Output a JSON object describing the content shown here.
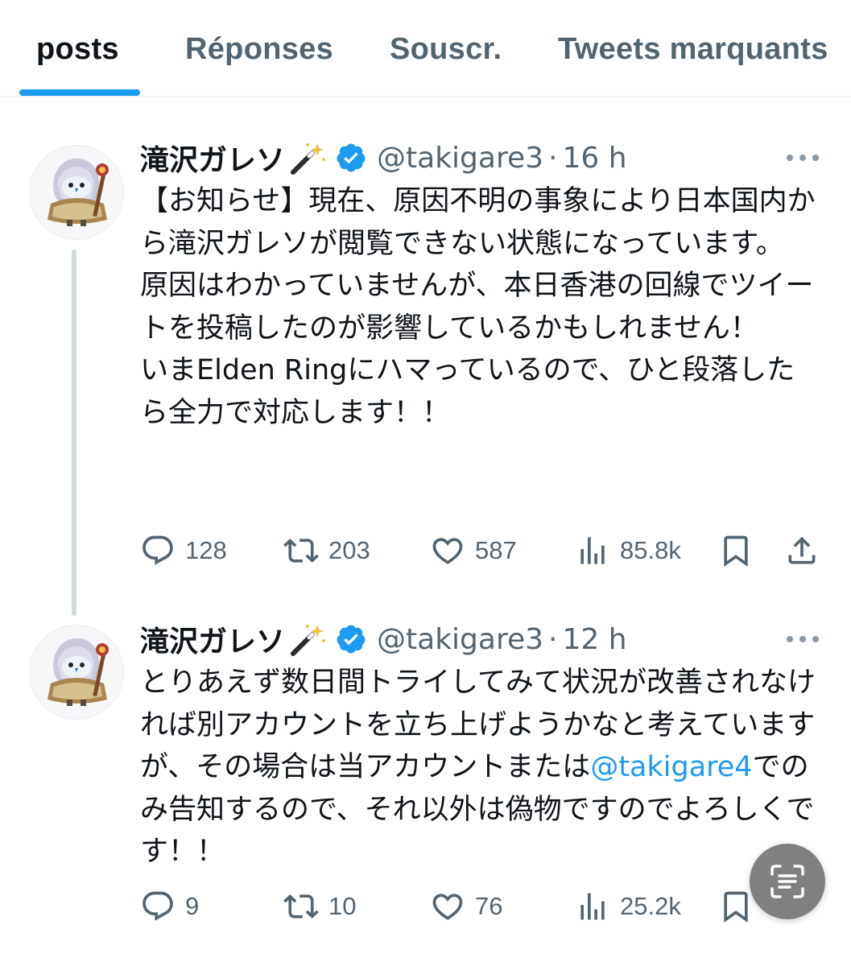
{
  "tabs": {
    "items": [
      {
        "label": "posts"
      },
      {
        "label": "Réponses"
      },
      {
        "label": "Souscr."
      },
      {
        "label": "Tweets marquants"
      }
    ]
  },
  "tweets": [
    {
      "display_name": "滝沢ガレソ",
      "handle": "@takigare3",
      "separator": "·",
      "time": "16 h",
      "text": "【お知らせ】現在、原因不明の事象により日本国内から滝沢ガレソが閲覧できない状態になっています。\n原因はわかっていませんが、本日香港の回線でツイートを投稿したのが影響しているかもしれません！\nいまElden Ringにハマっているので、ひと段落したら全力で対応します！！",
      "replies": "128",
      "retweets": "203",
      "likes": "587",
      "views": "85.8k"
    },
    {
      "display_name": "滝沢ガレソ",
      "handle": "@takigare3",
      "separator": "·",
      "time": "12 h",
      "text_before": "とりあえず数日間トライしてみて状況が改善されなければ別アカウントを立ち上げようかなと考えていますが、その場合は当アカウントまたは",
      "mention": "@takigare4",
      "text_after": "でのみ告知するので、それ以外は偽物ですのでよろしくです！！",
      "replies": "9",
      "retweets": "10",
      "likes": "76",
      "views": "25.2k"
    }
  ],
  "colors": {
    "accent": "#1d9bf0",
    "text_primary": "#0f1419",
    "text_secondary": "#536471",
    "divider": "#eff3f4"
  },
  "icons": {
    "verified": "verified-badge-icon",
    "wand": "magic-wand-emoji",
    "more": "more-options-icon",
    "reply": "reply-icon",
    "retweet": "retweet-icon",
    "like": "heart-icon",
    "views": "views-icon",
    "bookmark": "bookmark-icon",
    "share": "share-icon",
    "scan": "text-scan-icon"
  }
}
